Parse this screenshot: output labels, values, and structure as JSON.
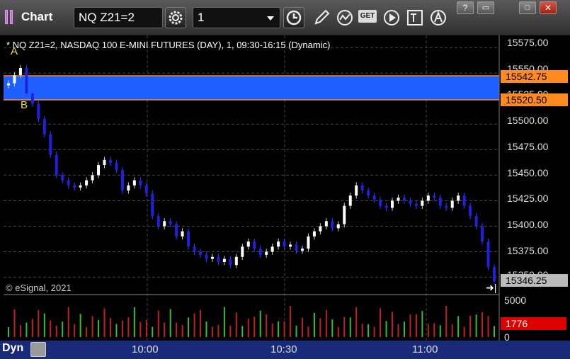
{
  "window": {
    "title": "Chart",
    "symbol": "NQ Z21=2",
    "interval": "1"
  },
  "toolbar": {
    "icons": [
      "gear-icon",
      "clock-icon",
      "pencil-icon",
      "study-icon",
      "get-icon",
      "play-icon",
      "text-icon",
      "alert-icon"
    ],
    "get_label": "GET"
  },
  "chart": {
    "header": "* NQ Z21=2, NASDAQ 100 E-MINI FUTURES (DAY), 1, 09:30-16:15 (Dynamic)",
    "copyright": "© eSignal, 2021",
    "label_a": "A",
    "label_b": "B",
    "band_color": "#1e5fff",
    "band_line_color": "#ff8a20",
    "up_color": "#ffffff",
    "down_color": "#2020e0"
  },
  "price_axis": {
    "labels": [
      "15575.00",
      "15550.00",
      "15525.00",
      "15500.00",
      "15475.00",
      "15450.00",
      "15425.00",
      "15400.00",
      "15375.00",
      "15350.00"
    ],
    "band_top": "15542.75",
    "band_bottom": "15520.50",
    "last_price": "15346.25"
  },
  "volume_axis": {
    "top": "5000",
    "current": "1776",
    "bottom": "0"
  },
  "time_axis": {
    "labels": [
      "10:00",
      "10:30",
      "11:00"
    ]
  },
  "bottom": {
    "mode": "Dyn"
  },
  "chart_data": {
    "type": "candlestick",
    "title": "NQ Z21=2, NASDAQ 100 E-MINI FUTURES (DAY), 1, 09:30-16:15 (Dynamic)",
    "x_labels": [
      "10:00",
      "10:30",
      "11:00"
    ],
    "ylim": [
      15340,
      15580
    ],
    "close_approx": [
      15540,
      15548,
      15555,
      15530,
      15520,
      15505,
      15490,
      15470,
      15450,
      15445,
      15440,
      15438,
      15440,
      15445,
      15450,
      15460,
      15465,
      15462,
      15455,
      15435,
      15440,
      15445,
      15440,
      15432,
      15410,
      15400,
      15405,
      15402,
      15390,
      15395,
      15380,
      15375,
      15372,
      15368,
      15370,
      15365,
      15368,
      15362,
      15370,
      15380,
      15385,
      15378,
      15372,
      15375,
      15380,
      15385,
      15380,
      15382,
      15376,
      15378,
      15390,
      15395,
      15400,
      15405,
      15398,
      15402,
      15420,
      15430,
      15440,
      15435,
      15430,
      15426,
      15420,
      15418,
      15425,
      15428,
      15425,
      15422,
      15420,
      15425,
      15430,
      15428,
      15420,
      15418,
      15425,
      15430,
      15420,
      15410,
      15400,
      15385,
      15360,
      15346
    ],
    "volume_max": 5000,
    "volume_current": 1776
  }
}
